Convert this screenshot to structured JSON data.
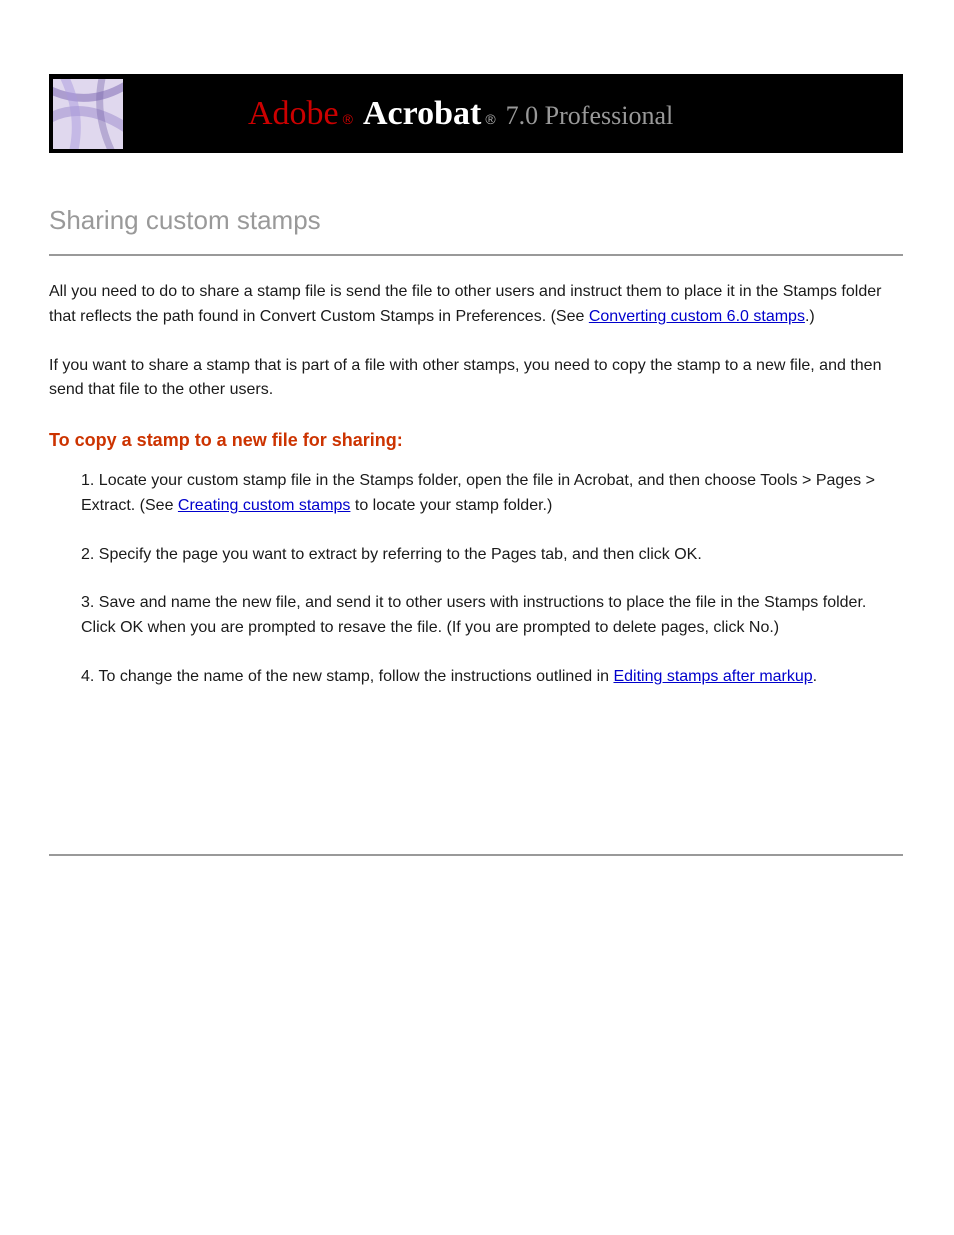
{
  "banner": {
    "adobe": "Adobe",
    "acrobat": "Acrobat",
    "reg": "®",
    "version": "7.0 Professional"
  },
  "title": "Sharing custom stamps",
  "paragraphs": {
    "p1": "All you need to do to share a stamp file is send the file to other users and instruct them to place it in the Stamps folder that reflects the path found in Convert Custom Stamps in",
    "p1_link": "Preferences. (See ",
    "p1_link_text": "Converting custom 6.0 stamps",
    "p1_link_after": ".)",
    "p2": "If you want to share a stamp that is part of a file with other stamps, you need to copy the stamp to a new file, and then send that file to the other users."
  },
  "howto": {
    "heading": "To copy a stamp to a new file for sharing:",
    "step1_a": "1.  Locate your custom stamp file in the Stamps folder, open the file in Acrobat, and then choose Tools > Pages > Extract. (See ",
    "step1_link": "Creating custom stamps",
    "step1_b": " to locate your stamp folder.)",
    "step2": "2.  Specify the page you want to extract by referring to the Pages tab, and then click OK.",
    "step3": "3.  Save and name the new file, and send it to other users with instructions to place the file in the Stamps folder. Click OK when you are prompted to resave the file. (If you are prompted to delete pages, click No.)",
    "step4_a": "4.  To change the name of the new stamp, follow the instructions outlined in ",
    "step4_link": "Editing stamps after markup",
    "step4_b": "."
  }
}
